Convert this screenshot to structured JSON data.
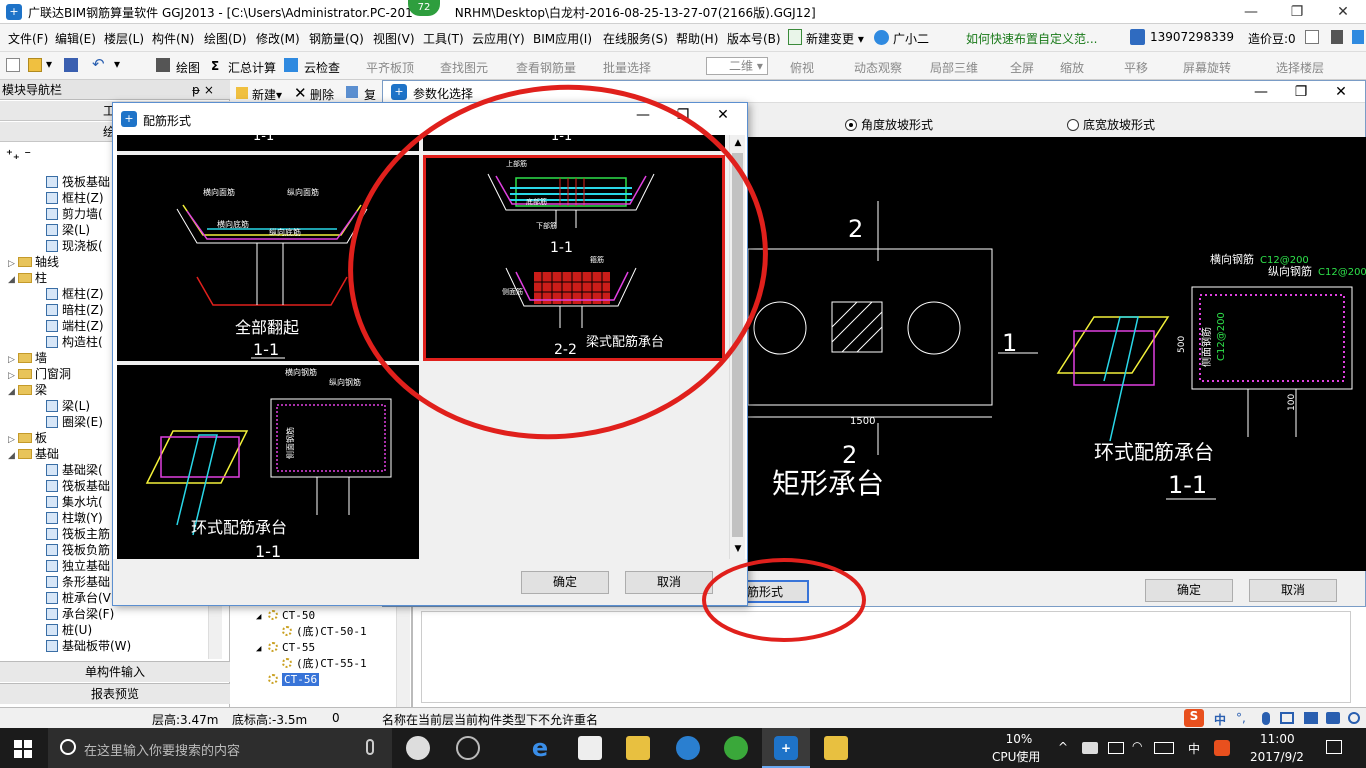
{
  "app": {
    "title": "广联达BIM钢筋算量软件 GGJ2013 - [C:\\Users\\Administrator.PC-201",
    "title_tail": "NRHM\\Desktop\\白龙村-2016-08-25-13-27-07(2166版).GGJ12]",
    "badge": "72",
    "icon_label": "+"
  },
  "window_controls": {
    "minimize": "—",
    "restore": "❐",
    "close": "✕"
  },
  "menu": [
    "文件(F)",
    "编辑(E)",
    "楼层(L)",
    "构件(N)",
    "绘图(D)",
    "修改(M)",
    "钢筋量(Q)",
    "视图(V)",
    "工具(T)",
    "云应用(Y)",
    "BIM应用(I)",
    "在线服务(S)",
    "帮助(H)",
    "版本号(B)"
  ],
  "menu_right": {
    "new_change": "新建变更",
    "assistant": "广小二",
    "link": "如何快速布置自定义范...",
    "phone": "13907298339",
    "points": "造价豆:0"
  },
  "toolbar": {
    "draw": "绘图",
    "sum": "汇总计算",
    "cloud_check": "云检查",
    "flat_top": "平齐板顶",
    "find": "查找图元",
    "view_rebar": "查看钢筋量",
    "batch_select": "批量选择",
    "view_2d": "二维",
    "top_view": "俯视",
    "dynamic": "动态观察",
    "local_3d": "局部三维",
    "fullscreen": "全屏",
    "zoom": "缩放",
    "pan": "平移",
    "rotate": "屏幕旋转",
    "select_floor": "选择楼层"
  },
  "left_panel": {
    "header": "模块导航栏",
    "pin": "ᵽ ×",
    "tabs": [
      "工程",
      "绘图"
    ],
    "tree": [
      {
        "label": "筏板基础",
        "type": "leaf"
      },
      {
        "label": "框柱(Z)",
        "type": "leaf"
      },
      {
        "label": "剪力墙(",
        "type": "leaf"
      },
      {
        "label": "梁(L)",
        "type": "leaf"
      },
      {
        "label": "现浇板(",
        "type": "leaf"
      },
      {
        "label": "轴线",
        "type": "folder",
        "exp": "▷"
      },
      {
        "label": "柱",
        "type": "folder",
        "exp": "◢"
      },
      {
        "label": "框柱(Z)",
        "type": "leaf"
      },
      {
        "label": "暗柱(Z)",
        "type": "leaf"
      },
      {
        "label": "端柱(Z)",
        "type": "leaf"
      },
      {
        "label": "构造柱(",
        "type": "leaf"
      },
      {
        "label": "墙",
        "type": "folder",
        "exp": "▷"
      },
      {
        "label": "门窗洞",
        "type": "folder",
        "exp": "▷"
      },
      {
        "label": "梁",
        "type": "folder",
        "exp": "◢"
      },
      {
        "label": "梁(L)",
        "type": "leaf"
      },
      {
        "label": "圈梁(E)",
        "type": "leaf"
      },
      {
        "label": "板",
        "type": "folder",
        "exp": "▷"
      },
      {
        "label": "基础",
        "type": "folder",
        "exp": "◢"
      },
      {
        "label": "基础梁(",
        "type": "leaf"
      },
      {
        "label": "筏板基础",
        "type": "leaf"
      },
      {
        "label": "集水坑(",
        "type": "leaf"
      },
      {
        "label": "柱墩(Y)",
        "type": "leaf"
      },
      {
        "label": "筏板主筋",
        "type": "leaf"
      },
      {
        "label": "筏板负筋",
        "type": "leaf"
      },
      {
        "label": "独立基础",
        "type": "leaf"
      },
      {
        "label": "条形基础",
        "type": "leaf"
      },
      {
        "label": "桩承台(V",
        "type": "leaf"
      },
      {
        "label": "承台梁(F)",
        "type": "leaf"
      },
      {
        "label": "桩(U)",
        "type": "leaf"
      },
      {
        "label": "基础板带(W)",
        "type": "leaf"
      }
    ],
    "bottom_buttons": [
      "单构件输入",
      "报表预览"
    ]
  },
  "mid_panel": {
    "new_btn": "新建",
    "delete_btn": "删除",
    "copy_btn": "复",
    "items": [
      {
        "label": "CT-50",
        "level": 0,
        "exp": "◢"
      },
      {
        "label": "(底)CT-50-1",
        "level": 1,
        "exp": ""
      },
      {
        "label": "CT-55",
        "level": 0,
        "exp": "◢"
      },
      {
        "label": "(底)CT-55-1",
        "level": 1,
        "exp": ""
      },
      {
        "label": "CT-56",
        "level": 0,
        "exp": "",
        "selected": true
      }
    ]
  },
  "param_dialog": {
    "title": "参数化选择",
    "radio_angle": "角度放坡形式",
    "radio_bottom": "底宽放坡形式",
    "rebar_form_btn": "配筋形式",
    "ok": "确定",
    "cancel": "取消",
    "canvas": {
      "section_2": "2",
      "section_1": "1",
      "dim_1500": "1500",
      "rect_title": "矩形承台",
      "ring_title": "环式配筋承台",
      "ring_section": "1-1",
      "hor_rebar": "横向钢筋",
      "hor_spec": "C12@200",
      "long_rebar": "纵向钢筋",
      "long_spec": "C12@200",
      "side_rebar": "侧面钢筋",
      "side_spec": "C12@200",
      "dim_500": "500",
      "dim_100": "100"
    }
  },
  "rebar_dialog": {
    "title": "配筋形式",
    "ok": "确定",
    "cancel": "取消",
    "cells": {
      "full_fold": "全部翻起",
      "full_fold_sec": "1-1",
      "beam_type": "梁式配筋承台",
      "beam_sec1": "1-1",
      "beam_sec2": "2-2",
      "ring_type": "环式配筋承台",
      "ring_sec": "1-1",
      "top_sec": "1-1",
      "lbl_hor": "横向面筋",
      "lbl_long": "纵向面筋",
      "lbl_hor_bottom": "横向底筋",
      "lbl_long_bottom": "纵向底筋",
      "lbl_top": "上部筋",
      "lbl_bottom": "下部筋",
      "lbl_bottom2": "底部筋",
      "lbl_hor_r": "横向钢筋",
      "lbl_long_r": "纵向钢筋",
      "lbl_side": "侧面钢筋",
      "lbl_stirrup": "箍筋",
      "lbl_side2": "侧面筋"
    }
  },
  "status_bar": {
    "floor_height": "层高:3.47m",
    "bottom_height": "底标高:-3.5m",
    "zero": "0",
    "message": "名称在当前层当前构件类型下不允许重名"
  },
  "ime": {
    "s": "S",
    "zh": "中",
    "dots": "°,"
  },
  "taskbar": {
    "search_placeholder": "在这里输入你要搜索的内容",
    "cpu_pct": "10%",
    "cpu_label": "CPU使用",
    "lang": "中",
    "time": "11:00",
    "date": "2017/9/2"
  },
  "colors": {
    "annotation_red": "#e0201c",
    "cad_cyan": "#29d7e8",
    "cad_magenta": "#e040e0",
    "cad_yellow": "#f2f03a",
    "cad_green": "#2ee04a",
    "selected_blue": "#3874d8"
  }
}
